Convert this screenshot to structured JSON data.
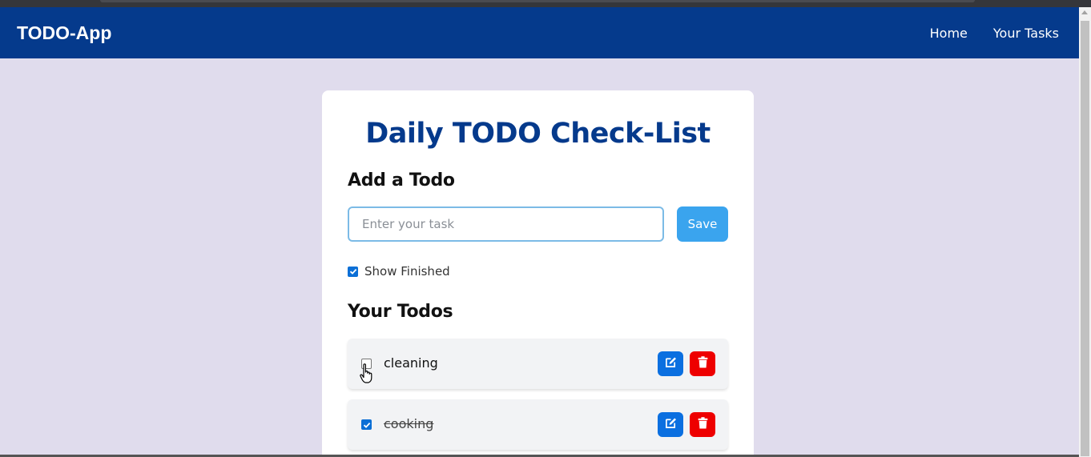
{
  "navbar": {
    "brand": "TODO-App",
    "links": [
      "Home",
      "Your Tasks"
    ]
  },
  "main": {
    "title": "Daily TODO Check-List",
    "add_heading": "Add a Todo",
    "input": {
      "placeholder": "Enter your task",
      "value": ""
    },
    "save_label": "Save",
    "show_finished": {
      "label": "Show Finished",
      "checked": true
    },
    "todos_heading": "Your Todos",
    "todos": [
      {
        "text": "cleaning",
        "done": false
      },
      {
        "text": "cooking",
        "done": true
      }
    ]
  },
  "icons": {
    "edit": "edit-icon",
    "delete": "trash-icon"
  },
  "colors": {
    "navbar": "#053a8c",
    "background": "#e0dced",
    "save": "#3aa4ee",
    "edit": "#0b6fe0",
    "delete": "#ee0000"
  }
}
